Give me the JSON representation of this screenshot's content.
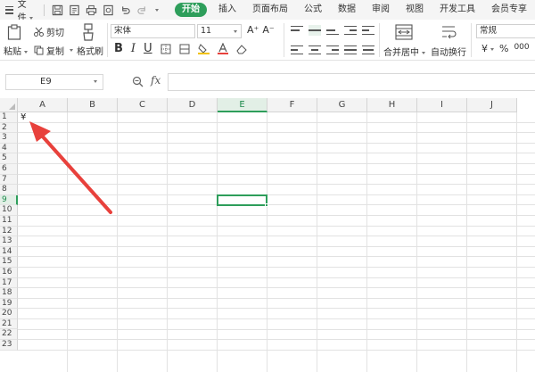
{
  "menubar": {
    "file_label": "文件",
    "tabs": [
      {
        "label": "开始",
        "active": true
      },
      {
        "label": "插入",
        "active": false
      },
      {
        "label": "页面布局",
        "active": false
      },
      {
        "label": "公式",
        "active": false
      },
      {
        "label": "数据",
        "active": false
      },
      {
        "label": "审阅",
        "active": false
      },
      {
        "label": "视图",
        "active": false
      },
      {
        "label": "开发工具",
        "active": false
      },
      {
        "label": "会员专享",
        "active": false
      }
    ],
    "quick_access_icons": [
      "save-icon",
      "export-pdf-icon",
      "print-icon",
      "print-preview-icon",
      "undo-icon",
      "redo-icon",
      "dropdown-icon"
    ],
    "accent_color": "#2e9e5b"
  },
  "ribbon": {
    "paste_label": "粘贴",
    "cut_label": "剪切",
    "copy_label": "复制",
    "format_painter_label": "格式刷",
    "font_name": "宋体",
    "font_size": "11",
    "bold": "B",
    "italic": "I",
    "underline": "U",
    "merge_label": "合并居中",
    "wrap_label": "自动换行",
    "number_format": "常规",
    "currency_symbol": "¥",
    "percent_symbol": "%",
    "thousands_symbol": "000"
  },
  "formula_bar": {
    "cell_ref": "E9",
    "fx_label": "fx",
    "formula_value": ""
  },
  "sheet": {
    "columns": [
      "A",
      "B",
      "C",
      "D",
      "E",
      "F",
      "G",
      "H",
      "I",
      "J"
    ],
    "rows": [
      "1",
      "2",
      "3",
      "4",
      "5",
      "6",
      "7",
      "8",
      "9",
      "10",
      "11",
      "12",
      "13",
      "14",
      "15",
      "16",
      "17",
      "18",
      "19",
      "20",
      "21",
      "22",
      "23"
    ],
    "selected_column": "E",
    "selected_row": "9",
    "a1_value": "¥",
    "annotation_arrow_color": "#e8413c"
  }
}
